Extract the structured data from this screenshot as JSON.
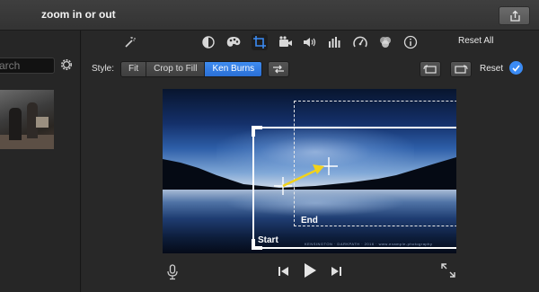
{
  "window": {
    "title": "zoom in or out"
  },
  "browser": {
    "search_placeholder": "arch"
  },
  "toolbar": {
    "icons": [
      "magic-wand-icon",
      "color-balance-icon",
      "color-correction-palette-icon",
      "crop-icon",
      "camera-icon",
      "volume-icon",
      "equalizer-icon",
      "speed-icon",
      "filter-icon",
      "info-icon"
    ],
    "reset_all_label": "Reset All"
  },
  "crop": {
    "style_label": "Style:",
    "styles": [
      "Fit",
      "Crop to Fill",
      "Ken Burns"
    ],
    "selected_style": "Ken Burns",
    "reset_label": "Reset"
  },
  "viewer": {
    "end_label": "End",
    "start_label": "Start",
    "caption": "KENSINGTON · DARKPATH · 2016 · www.example-photography"
  },
  "colors": {
    "accent": "#3b8bf4",
    "arrow": "#f2d21b",
    "background": "#282828"
  }
}
